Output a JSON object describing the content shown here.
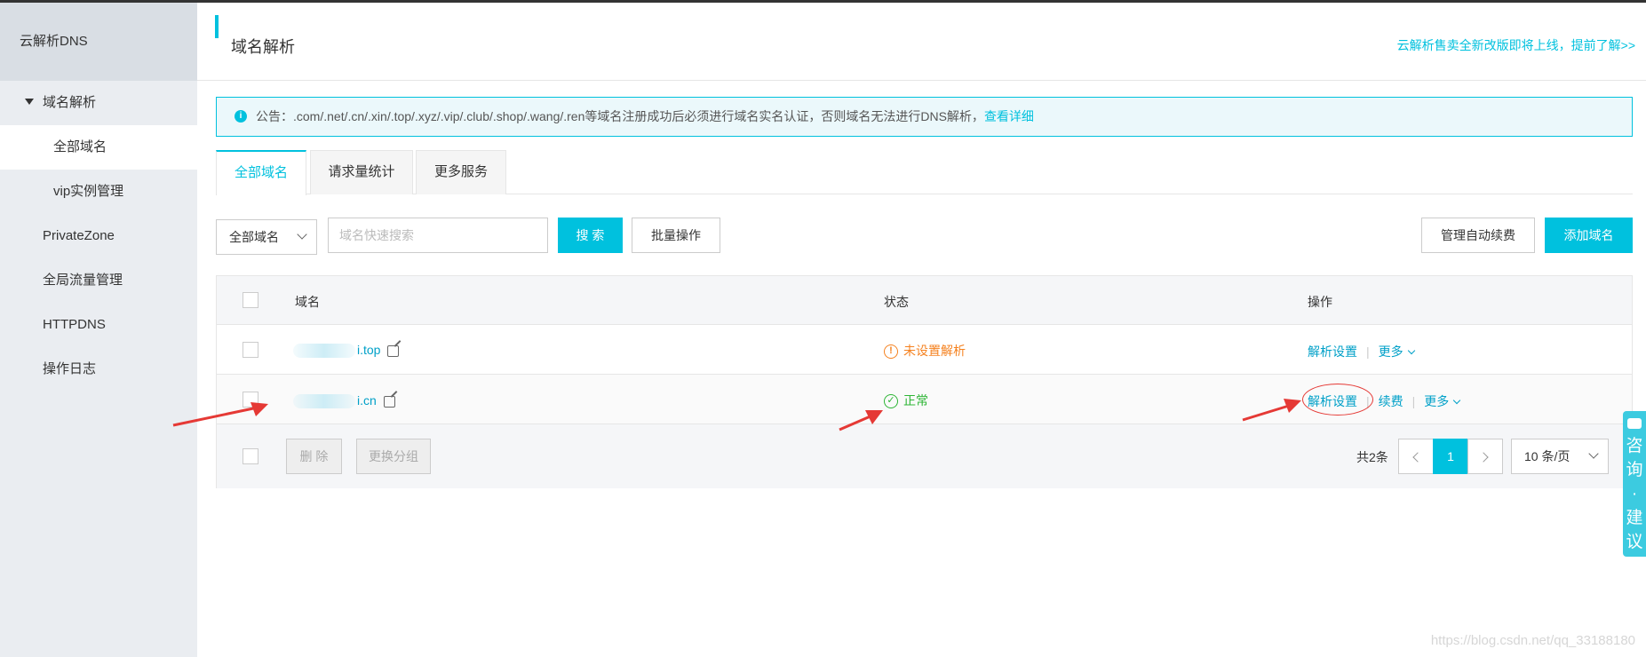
{
  "sidebar": {
    "title": "云解析DNS",
    "items": [
      {
        "label": "域名解析"
      },
      {
        "label": "全部域名"
      },
      {
        "label": "vip实例管理"
      },
      {
        "label": "PrivateZone"
      },
      {
        "label": "全局流量管理"
      },
      {
        "label": "HTTPDNS"
      },
      {
        "label": "操作日志"
      }
    ]
  },
  "header": {
    "title": "域名解析",
    "link": "云解析售卖全新改版即将上线，提前了解>>"
  },
  "notice": {
    "text": "公告：.com/.net/.cn/.xin/.top/.xyz/.vip/.club/.shop/.wang/.ren等域名注册成功后必须进行域名实名认证，否则域名无法进行DNS解析，",
    "link": "查看详细"
  },
  "tabs": [
    {
      "label": "全部域名"
    },
    {
      "label": "请求量统计"
    },
    {
      "label": "更多服务"
    }
  ],
  "toolbar": {
    "filter": "全部域名",
    "search_placeholder": "域名快速搜索",
    "search_label": "搜 索",
    "batch_label": "批量操作",
    "auto_renew_label": "管理自动续费",
    "add_domain_label": "添加域名"
  },
  "table": {
    "columns": [
      "域名",
      "状态",
      "操作"
    ],
    "rows": [
      {
        "domain": "i.top",
        "status": "未设置解析",
        "actions": {
          "resolve": "解析设置",
          "more": "更多"
        }
      },
      {
        "domain": "i.cn",
        "status": "正常",
        "actions": {
          "resolve": "解析设置",
          "renew": "续费",
          "more": "更多"
        }
      }
    ],
    "footer": {
      "delete_label": "删 除",
      "regroup_label": "更换分组",
      "total": "共2条",
      "current_page": "1",
      "page_size": "10 条/页"
    }
  },
  "float_widget": {
    "chars": [
      "咨",
      "询",
      "·",
      "建",
      "议"
    ]
  },
  "watermark": "https://blog.csdn.net/qq_33188180",
  "colors": {
    "accent": "#00c1de",
    "link": "#00a0c8",
    "warn": "#f58220",
    "ok": "#2db535",
    "annotation": "#e53935"
  }
}
